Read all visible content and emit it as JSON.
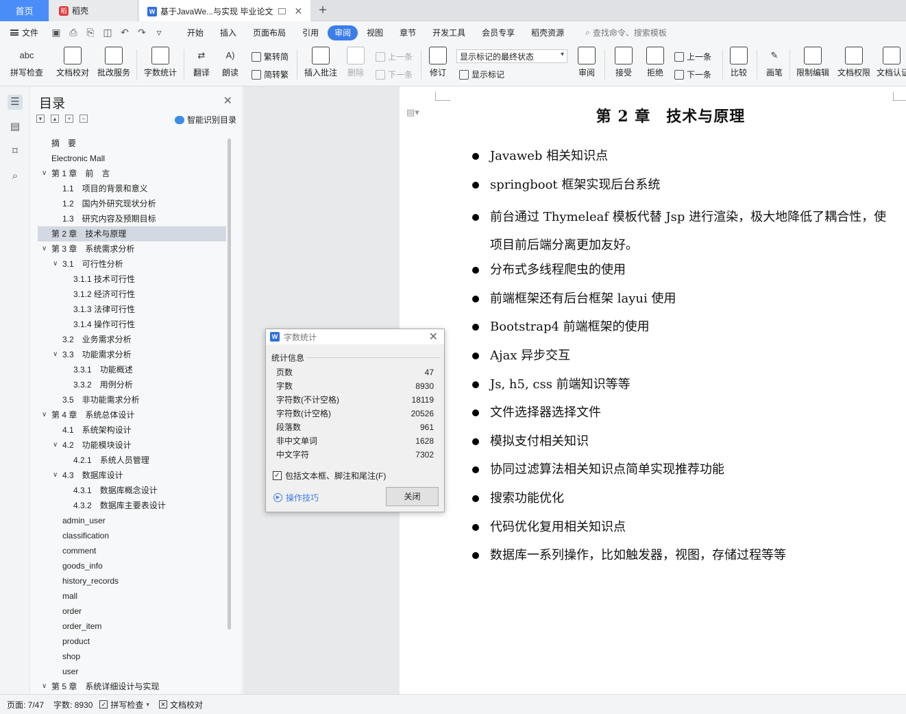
{
  "tabs": {
    "home": "首页",
    "daoke": "稻壳",
    "doc": "基于JavaWe...与实现 毕业论文"
  },
  "menu": {
    "file": "文件",
    "tabs": [
      "开始",
      "插入",
      "页面布局",
      "引用",
      "审阅",
      "视图",
      "章节",
      "开发工具",
      "会员专享",
      "稻壳资源"
    ],
    "active_tab": "审阅",
    "search": "查找命令、搜索模板"
  },
  "ribbon": {
    "spell_check": "拼写检查",
    "doc_proof": "文档校对",
    "revise_service": "批改服务",
    "word_count": "字数统计",
    "translate": "翻译",
    "read_aloud": "朗读",
    "trad_simp": "繁转简",
    "simp_trad": "简转繁",
    "insert_comment": "插入批注",
    "delete": "删除",
    "prev": "上一条",
    "next": "下一条",
    "track_changes": "修订",
    "markup_select": "显示标记的最终状态",
    "show_markup": "显示标记",
    "review": "审阅",
    "accept": "接受",
    "reject": "拒绝",
    "prev2": "上一条",
    "next2": "下一条",
    "compare": "比较",
    "pen": "画笔",
    "restrict_edit": "限制编辑",
    "doc_rights": "文档权限",
    "doc_cert": "文档认证"
  },
  "toc": {
    "title": "目录",
    "smart": "智能识别目录",
    "items": [
      {
        "label": "摘　要",
        "level": 1,
        "caret": ""
      },
      {
        "label": "Electronic Mall",
        "level": 1,
        "caret": ""
      },
      {
        "label": "第 1 章　前　言",
        "level": 1,
        "caret": "down"
      },
      {
        "label": "1.1　项目的背景和意义",
        "level": 2,
        "caret": ""
      },
      {
        "label": "1.2　国内外研究现状分析",
        "level": 2,
        "caret": ""
      },
      {
        "label": "1.3　研究内容及预期目标",
        "level": 2,
        "caret": ""
      },
      {
        "label": "第 2 章　技术与原理",
        "level": 1,
        "caret": "",
        "active": true
      },
      {
        "label": "第 3 章　系统需求分析",
        "level": 1,
        "caret": "down"
      },
      {
        "label": "3.1　可行性分析",
        "level": 2,
        "caret": "down"
      },
      {
        "label": "3.1.1  技术可行性",
        "level": 3,
        "caret": ""
      },
      {
        "label": "3.1.2  经济可行性",
        "level": 3,
        "caret": ""
      },
      {
        "label": "3.1.3  法律可行性",
        "level": 3,
        "caret": ""
      },
      {
        "label": "3.1.4  操作可行性",
        "level": 3,
        "caret": ""
      },
      {
        "label": "3.2　业务需求分析",
        "level": 2,
        "caret": ""
      },
      {
        "label": "3.3　功能需求分析",
        "level": 2,
        "caret": "down"
      },
      {
        "label": "3.3.1　功能概述",
        "level": 3,
        "caret": ""
      },
      {
        "label": "3.3.2　用例分析",
        "level": 3,
        "caret": ""
      },
      {
        "label": "3.5　非功能需求分析",
        "level": 2,
        "caret": ""
      },
      {
        "label": "第 4 章　系统总体设计",
        "level": 1,
        "caret": "down"
      },
      {
        "label": "4.1　系统架构设计",
        "level": 2,
        "caret": ""
      },
      {
        "label": "4.2　功能模块设计",
        "level": 2,
        "caret": "down"
      },
      {
        "label": "4.2.1　系统人员管理",
        "level": 3,
        "caret": ""
      },
      {
        "label": "4.3　数据库设计",
        "level": 2,
        "caret": "down"
      },
      {
        "label": "4.3.1　数据库概念设计",
        "level": 3,
        "caret": ""
      },
      {
        "label": "4.3.2　数据库主要表设计",
        "level": 3,
        "caret": ""
      },
      {
        "label": "admin_user",
        "level": 2,
        "caret": ""
      },
      {
        "label": "classification",
        "level": 2,
        "caret": ""
      },
      {
        "label": "comment",
        "level": 2,
        "caret": ""
      },
      {
        "label": "goods_info",
        "level": 2,
        "caret": ""
      },
      {
        "label": "history_records",
        "level": 2,
        "caret": ""
      },
      {
        "label": "mall",
        "level": 2,
        "caret": ""
      },
      {
        "label": "order",
        "level": 2,
        "caret": ""
      },
      {
        "label": "order_item",
        "level": 2,
        "caret": ""
      },
      {
        "label": "product",
        "level": 2,
        "caret": ""
      },
      {
        "label": "shop",
        "level": 2,
        "caret": ""
      },
      {
        "label": "user",
        "level": 2,
        "caret": ""
      },
      {
        "label": "第 5 章　系统详细设计与实现",
        "level": 1,
        "caret": "down"
      }
    ]
  },
  "document": {
    "chapter_title": "第 2 章　技术与原理",
    "bullets": [
      "Javaweb 相关知识点",
      "springboot 框架实现后台系统",
      "前台通过 Thymeleaf 模板代替 Jsp 进行渲染，极大地降低了耦合性，使项目前后端分离更加友好。",
      "分布式多线程爬虫的使用",
      "前端框架还有后台框架 layui 使用",
      "Bootstrap4 前端框架的使用",
      "Ajax 异步交互",
      "Js, h5, css 前端知识等等",
      "文件选择器选择文件",
      "模拟支付相关知识",
      "协同过滤算法相关知识点简单实现推荐功能",
      "搜索功能优化",
      "代码优化复用相关知识点",
      "数据库一系列操作，比如触发器，视图，存储过程等等"
    ]
  },
  "dialog": {
    "title": "字数统计",
    "section": "统计信息",
    "stats": [
      {
        "label": "页数",
        "value": "47"
      },
      {
        "label": "字数",
        "value": "8930"
      },
      {
        "label": "字符数(不计空格)",
        "value": "18119"
      },
      {
        "label": "字符数(计空格)",
        "value": "20526"
      },
      {
        "label": "段落数",
        "value": "961"
      },
      {
        "label": "非中文单词",
        "value": "1628"
      },
      {
        "label": "中文字符",
        "value": "7302"
      }
    ],
    "include_label": "包括文本框、脚注和尾注(F)",
    "include_checked": true,
    "tips": "操作技巧",
    "close": "关闭"
  },
  "status": {
    "page": "页面: 7/47",
    "words": "字数: 8930",
    "spell": "拼写检查",
    "proof": "文档校对"
  }
}
